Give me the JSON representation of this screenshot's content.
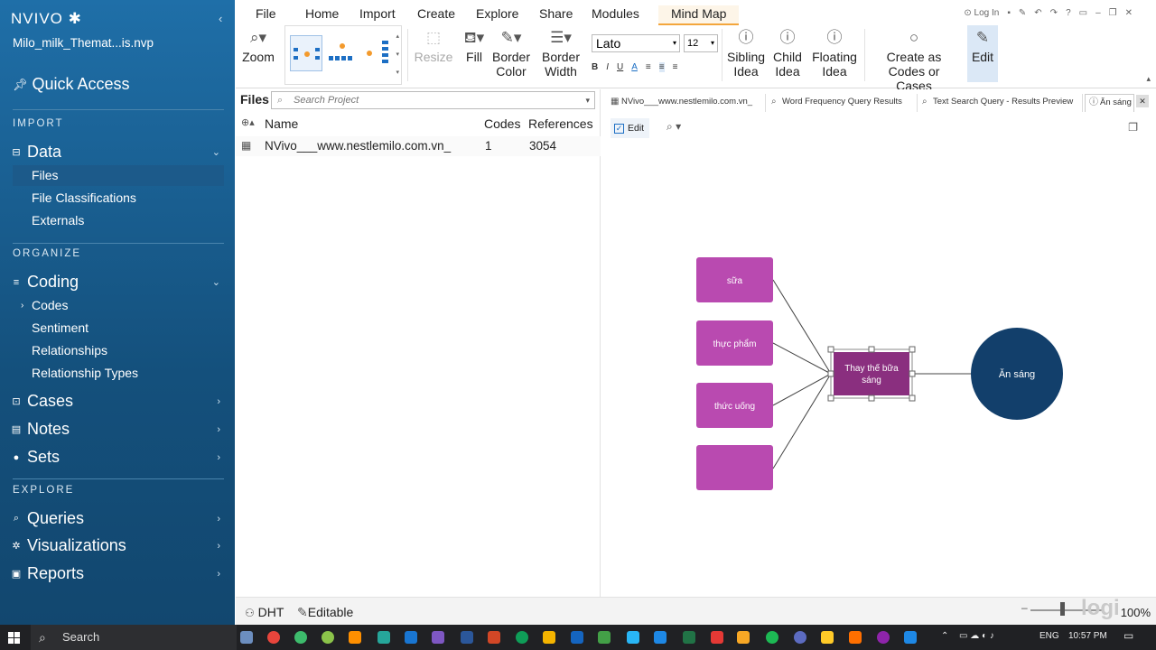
{
  "app": {
    "brand": "NVIVO",
    "project_name": "Milo_milk_Themat...is.nvp"
  },
  "sidebar": {
    "quick_access": "Quick Access",
    "sections": {
      "import": "IMPORT",
      "organize": "ORGANIZE",
      "explore": "EXPLORE"
    },
    "data": {
      "label": "Data",
      "items": [
        "Files",
        "File Classifications",
        "Externals"
      ]
    },
    "coding": {
      "label": "Coding",
      "items": [
        "Codes",
        "Sentiment",
        "Relationships",
        "Relationship Types"
      ]
    },
    "cases": "Cases",
    "notes": "Notes",
    "sets": "Sets",
    "queries": "Queries",
    "visualizations": "Visualizations",
    "reports": "Reports"
  },
  "ribbon": {
    "tabs": [
      "File",
      "Home",
      "Import",
      "Create",
      "Explore",
      "Share",
      "Modules",
      "Mind Map"
    ],
    "active_tab": "Mind Map",
    "login": "Log In",
    "zoom": "Zoom",
    "resize": "Resize",
    "fill": "Fill",
    "border_color": [
      "Border",
      "Color"
    ],
    "border_width": [
      "Border",
      "Width"
    ],
    "font": "Lato",
    "font_size": "12",
    "sibling_idea": [
      "Sibling",
      "Idea"
    ],
    "child_idea": [
      "Child",
      "Idea"
    ],
    "floating_idea": [
      "Floating",
      "Idea"
    ],
    "create_codes": [
      "Create as",
      "Codes or Cases"
    ],
    "edit": "Edit"
  },
  "files_pane": {
    "title": "Files",
    "search_placeholder": "Search Project",
    "columns": {
      "name": "Name",
      "codes": "Codes",
      "references": "References"
    },
    "rows": [
      {
        "name": "NVivo___www.nestlemilo.com.vn_",
        "codes": "1",
        "references": "3054"
      }
    ]
  },
  "doc_tabs": [
    "NVivo___www.nestlemilo.com.vn_",
    "Word Frequency Query Results",
    "Text Search Query - Results Preview",
    "Ăn sáng"
  ],
  "mindmap": {
    "edit_label": "Edit",
    "root": "Ăn sáng",
    "main_idea": [
      "Thay thế bữa",
      "sáng"
    ],
    "children": [
      "sữa",
      "thực phẩm",
      "thức uống",
      ""
    ],
    "colors": {
      "root": "#123f6b",
      "idea": "#b94ab0",
      "selected": "#8a2f7f"
    }
  },
  "status": {
    "user": "DHT",
    "mode": "Editable",
    "zoom": "100%",
    "watermark": "logi"
  },
  "taskbar": {
    "search": "Search",
    "lang": "ENG",
    "time": "10:57 PM"
  }
}
